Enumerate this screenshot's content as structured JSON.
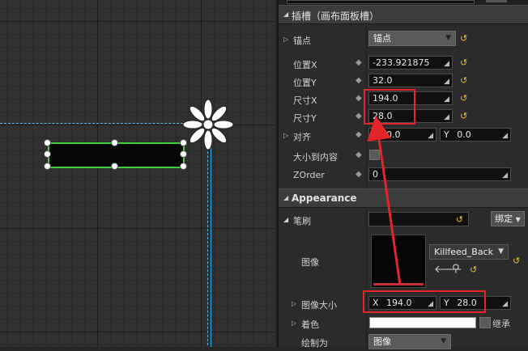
{
  "slot": {
    "section_title": "插槽（画布面板槽）",
    "anchors": {
      "label": "锚点",
      "value": "锚点"
    },
    "position_x": {
      "label": "位置X",
      "value": "-233.921875"
    },
    "position_y": {
      "label": "位置Y",
      "value": "32.0"
    },
    "size_x": {
      "label": "尺寸X",
      "value": "194.0"
    },
    "size_y": {
      "label": "尺寸Y",
      "value": "28.0"
    },
    "alignment": {
      "label": "对齐",
      "x_label": "X",
      "x_value": "0.0",
      "y_label": "Y",
      "y_value": "0.0"
    },
    "size_to_content": {
      "label": "大小到内容"
    },
    "zorder": {
      "label": "ZOrder",
      "value": "0"
    }
  },
  "appearance": {
    "section_title": "Appearance",
    "brush": {
      "label": "笔刷",
      "bind_label": "绑定"
    },
    "image": {
      "label": "图像",
      "asset_name": "Killfeed_Back"
    },
    "image_size": {
      "label": "图像大小",
      "x_label": "X",
      "x_value": "194.0",
      "y_label": "Y",
      "y_value": "28.0"
    },
    "tint": {
      "label": "着色",
      "inherit_label": "继承"
    },
    "draw_as": {
      "label": "绘制为",
      "value": "图像"
    }
  },
  "colors": {
    "highlight": "#e3242b",
    "selection": "#3cd23c",
    "guide": "#5ab4e6",
    "reset": "#e8c02a"
  }
}
